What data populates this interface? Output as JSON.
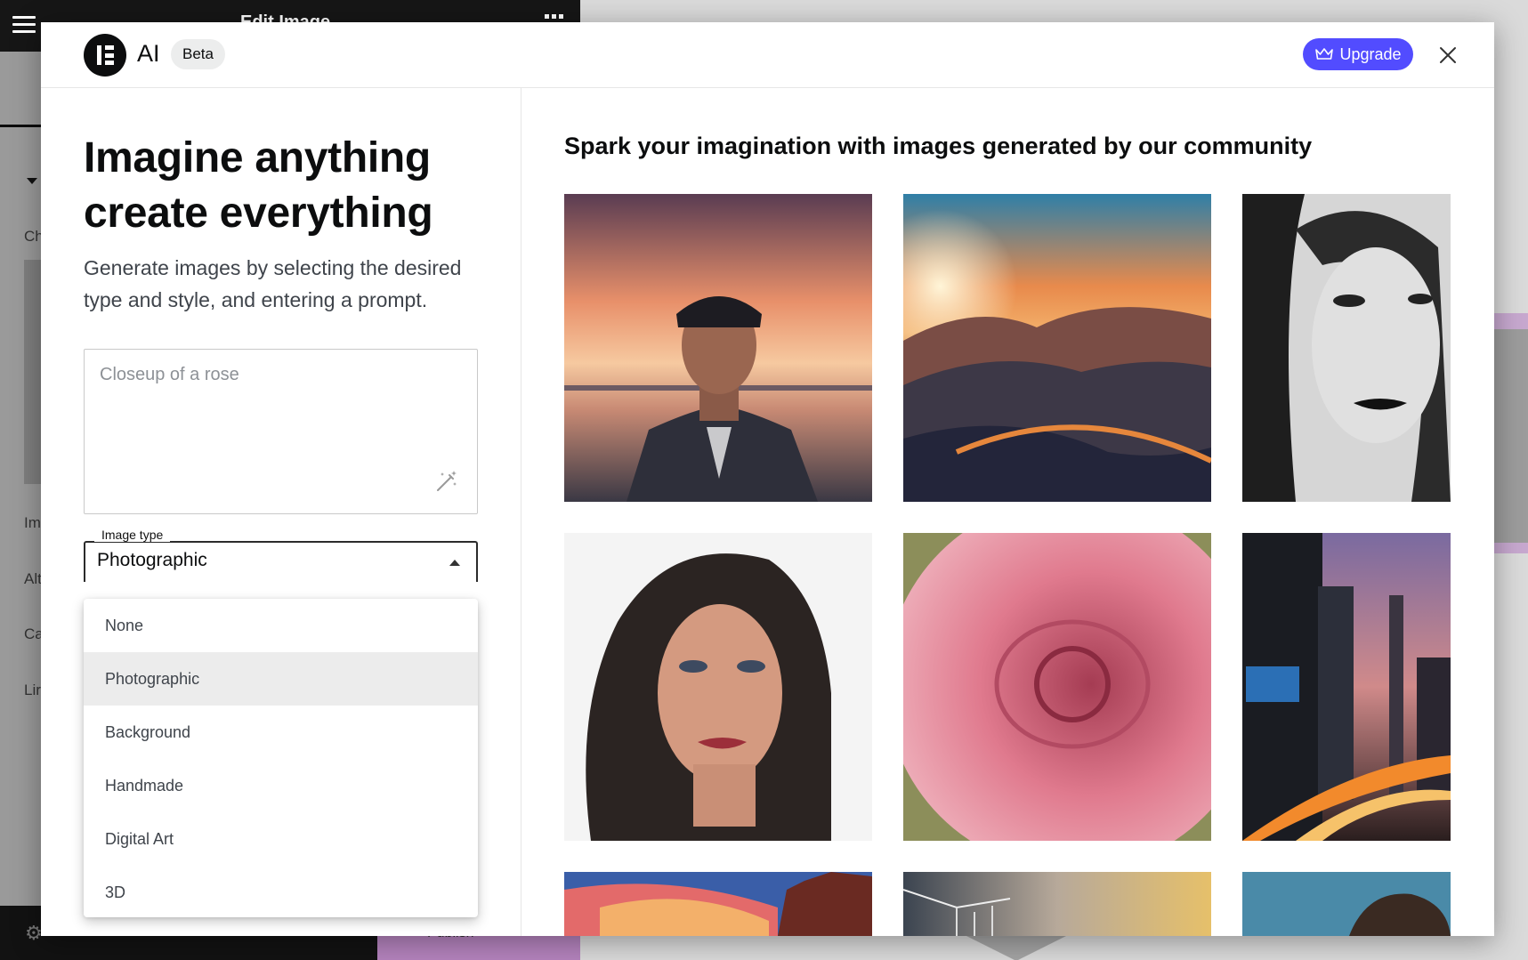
{
  "background_editor": {
    "topbar_title": "Edit Image",
    "side_labels": [
      "Ch",
      "Im",
      "Alt",
      "Ca",
      "Lir"
    ],
    "publish_label": "Publish"
  },
  "header": {
    "brand": "AI",
    "badge": "Beta",
    "upgrade_label": "Upgrade"
  },
  "left": {
    "headline_line1": "Imagine anything",
    "headline_line2": "create everything",
    "subtext": "Generate images by selecting the desired type and style, and entering a prompt.",
    "prompt_placeholder": "Closeup of a rose",
    "image_type": {
      "label": "Image type",
      "value": "Photographic",
      "options": [
        "None",
        "Photographic",
        "Background",
        "Handmade",
        "Digital Art",
        "3D"
      ],
      "selected_index": 1
    }
  },
  "gallery": {
    "title": "Spark your imagination with images generated by our community",
    "images": [
      "elderly-man-sunset",
      "mountain-sunset",
      "bw-woman-portrait",
      "woman-portrait",
      "pink-rose",
      "city-night-lights",
      "colorful-sky-rocks",
      "bridge-bokeh",
      "woman-partial"
    ]
  },
  "colors": {
    "accent": "#524cff",
    "text": "#0c0d0e",
    "menu_selected": "#ececec"
  }
}
